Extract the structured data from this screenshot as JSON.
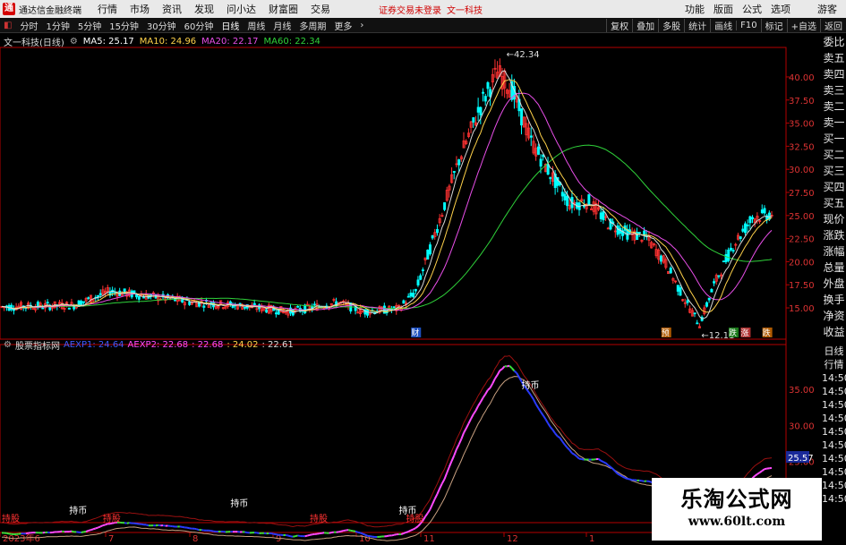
{
  "menubar": {
    "app_title": "通达信金融终端",
    "menus": [
      "行情",
      "市场",
      "资讯",
      "发现",
      "问小达",
      "财富圈",
      "交易"
    ],
    "warning": "证券交易未登录",
    "stock_link": "文一科技",
    "right_menus": [
      "功能",
      "版面",
      "公式",
      "选项"
    ],
    "guest": "游客"
  },
  "toolbar": {
    "periods": [
      "分时",
      "1分钟",
      "5分钟",
      "15分钟",
      "30分钟",
      "60分钟",
      "日线",
      "周线",
      "月线",
      "多周期",
      "更多"
    ],
    "active": "日线",
    "right_tools": [
      "复权",
      "叠加",
      "多股",
      "统计",
      "画线",
      "F10",
      "标记",
      "+自选",
      "返回"
    ]
  },
  "stock_info": {
    "name": "文一科技(日线)",
    "ma5": "MA5: 25.17",
    "ma10": "MA10: 24.96",
    "ma20": "MA20: 22.17",
    "ma60": "MA60: 22.34"
  },
  "colors": {
    "up": "#ff3232",
    "down": "#00ffff",
    "ma5": "#ffffff",
    "ma10": "#ffd24a",
    "ma20": "#e84ee8",
    "ma60": "#2fd23a",
    "axis": "#b50000"
  },
  "indicator": {
    "name": "股票指标网",
    "aexp1": "AEXP1: 24.64",
    "aexp2": "AEXP2: 22.68",
    "v3": ": 22.68",
    "v4": ": 24.02",
    "v5": ": 22.61",
    "current_value": "25.57"
  },
  "markers": {
    "high": "42.34",
    "low": "12.11",
    "cai": "财",
    "t1": "预",
    "t2": "跌",
    "t3": "涨",
    "t4": "跌",
    "hold1": "持币",
    "hold2": "持币",
    "hold3": "持币",
    "hold4": "持币",
    "hold5": "持股",
    "hold6": "持股",
    "hold7": "持股",
    "hold8": "持股"
  },
  "price_axis": [
    "40.00",
    "37.50",
    "35.00",
    "32.50",
    "30.00",
    "27.50",
    "25.00",
    "22.50",
    "20.00",
    "17.50",
    "15.00"
  ],
  "indicator_axis": [
    "35.00",
    "30.00",
    "25.00"
  ],
  "date_axis": [
    "2023年6",
    "7",
    "8",
    "9",
    "10",
    "11",
    "12",
    "1"
  ],
  "side_quote": [
    "委比",
    "卖五",
    "卖四",
    "卖三",
    "卖二",
    "卖一",
    "买一",
    "买二",
    "买三",
    "买四",
    "买五",
    "现价",
    "涨跌",
    "涨幅",
    "总量",
    "外盘",
    "换手",
    "净资",
    "收益"
  ],
  "side_tick": [
    "日线",
    "行情",
    "14:50",
    "14:50",
    "14:50",
    "14:50",
    "14:50",
    "14:50",
    "14:50",
    "14:50",
    "14:50",
    "14:50"
  ],
  "watermark": {
    "line1": "乐淘公式网",
    "line2": "www.60lt.com"
  },
  "chart_data": {
    "type": "candlestick",
    "title": "文一科技(日线)",
    "ylim": [
      12,
      43
    ],
    "x_range": [
      "2023-06",
      "2024-01"
    ],
    "ohlc_samples": [
      {
        "d": "2023-06",
        "close": 15.1
      },
      {
        "d": "2023-07",
        "close": 16.9
      },
      {
        "d": "2023-08",
        "close": 16.0
      },
      {
        "d": "2023-09",
        "close": 14.6
      },
      {
        "d": "2023-10",
        "close": 14.8
      },
      {
        "d": "2023-11",
        "close": 35.0
      },
      {
        "d": "2023-11-high",
        "close": 42.34
      },
      {
        "d": "2023-12",
        "close": 28.0
      },
      {
        "d": "2024-01-low",
        "close": 12.11
      },
      {
        "d": "2024-01",
        "close": 25.17
      }
    ],
    "series": [
      {
        "name": "MA5",
        "last": 25.17
      },
      {
        "name": "MA10",
        "last": 24.96
      },
      {
        "name": "MA20",
        "last": 22.17
      },
      {
        "name": "MA60",
        "last": 22.34
      }
    ],
    "indicator": {
      "name": "股票指标网",
      "series": [
        {
          "name": "AEXP1",
          "last": 24.64
        },
        {
          "name": "AEXP2",
          "last": 22.68
        }
      ],
      "ylim": [
        17,
        40
      ]
    }
  }
}
